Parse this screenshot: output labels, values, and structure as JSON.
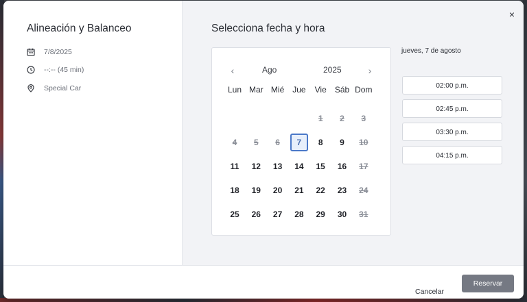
{
  "service": {
    "title": "Alineación y Balanceo",
    "date": "7/8/2025",
    "time": "--:-- (45 min)",
    "location": "Special Car"
  },
  "panel": {
    "title": "Selecciona fecha y hora",
    "selected_date_label": "jueves, 7 de agosto"
  },
  "calendar": {
    "prev": "‹",
    "next": "›",
    "month": "Ago",
    "year": "2025",
    "weekdays": [
      "Lun",
      "Mar",
      "Mié",
      "Jue",
      "Vie",
      "Sáb",
      "Dom"
    ],
    "weeks": [
      [
        null,
        null,
        null,
        null,
        {
          "d": "1",
          "state": "disabled"
        },
        {
          "d": "2",
          "state": "disabled"
        },
        {
          "d": "3",
          "state": "disabled"
        }
      ],
      [
        {
          "d": "4",
          "state": "disabled"
        },
        {
          "d": "5",
          "state": "disabled"
        },
        {
          "d": "6",
          "state": "disabled"
        },
        {
          "d": "7",
          "state": "selected"
        },
        {
          "d": "8",
          "state": "available"
        },
        {
          "d": "9",
          "state": "available"
        },
        {
          "d": "10",
          "state": "disabled"
        }
      ],
      [
        {
          "d": "11",
          "state": "available"
        },
        {
          "d": "12",
          "state": "available"
        },
        {
          "d": "13",
          "state": "available"
        },
        {
          "d": "14",
          "state": "available"
        },
        {
          "d": "15",
          "state": "available"
        },
        {
          "d": "16",
          "state": "available"
        },
        {
          "d": "17",
          "state": "disabled"
        }
      ],
      [
        {
          "d": "18",
          "state": "available"
        },
        {
          "d": "19",
          "state": "available"
        },
        {
          "d": "20",
          "state": "available"
        },
        {
          "d": "21",
          "state": "available"
        },
        {
          "d": "22",
          "state": "available"
        },
        {
          "d": "23",
          "state": "available"
        },
        {
          "d": "24",
          "state": "disabled"
        }
      ],
      [
        {
          "d": "25",
          "state": "available"
        },
        {
          "d": "26",
          "state": "available"
        },
        {
          "d": "27",
          "state": "available"
        },
        {
          "d": "28",
          "state": "available"
        },
        {
          "d": "29",
          "state": "available"
        },
        {
          "d": "30",
          "state": "available"
        },
        {
          "d": "31",
          "state": "disabled"
        }
      ]
    ]
  },
  "slots": [
    "02:00 p.m.",
    "02:45 p.m.",
    "03:30 p.m.",
    "04:15 p.m."
  ],
  "footer": {
    "cancel_label": "Cancelar",
    "reserve_label": "Reservar"
  },
  "close_label": "×",
  "colors": {
    "accent": "#4a78c8",
    "reserve_button": "#757983",
    "disabled_day": "#8b8f98"
  },
  "icons": {
    "date": "calendar-icon",
    "time": "clock-icon",
    "location": "location-pin-icon"
  }
}
